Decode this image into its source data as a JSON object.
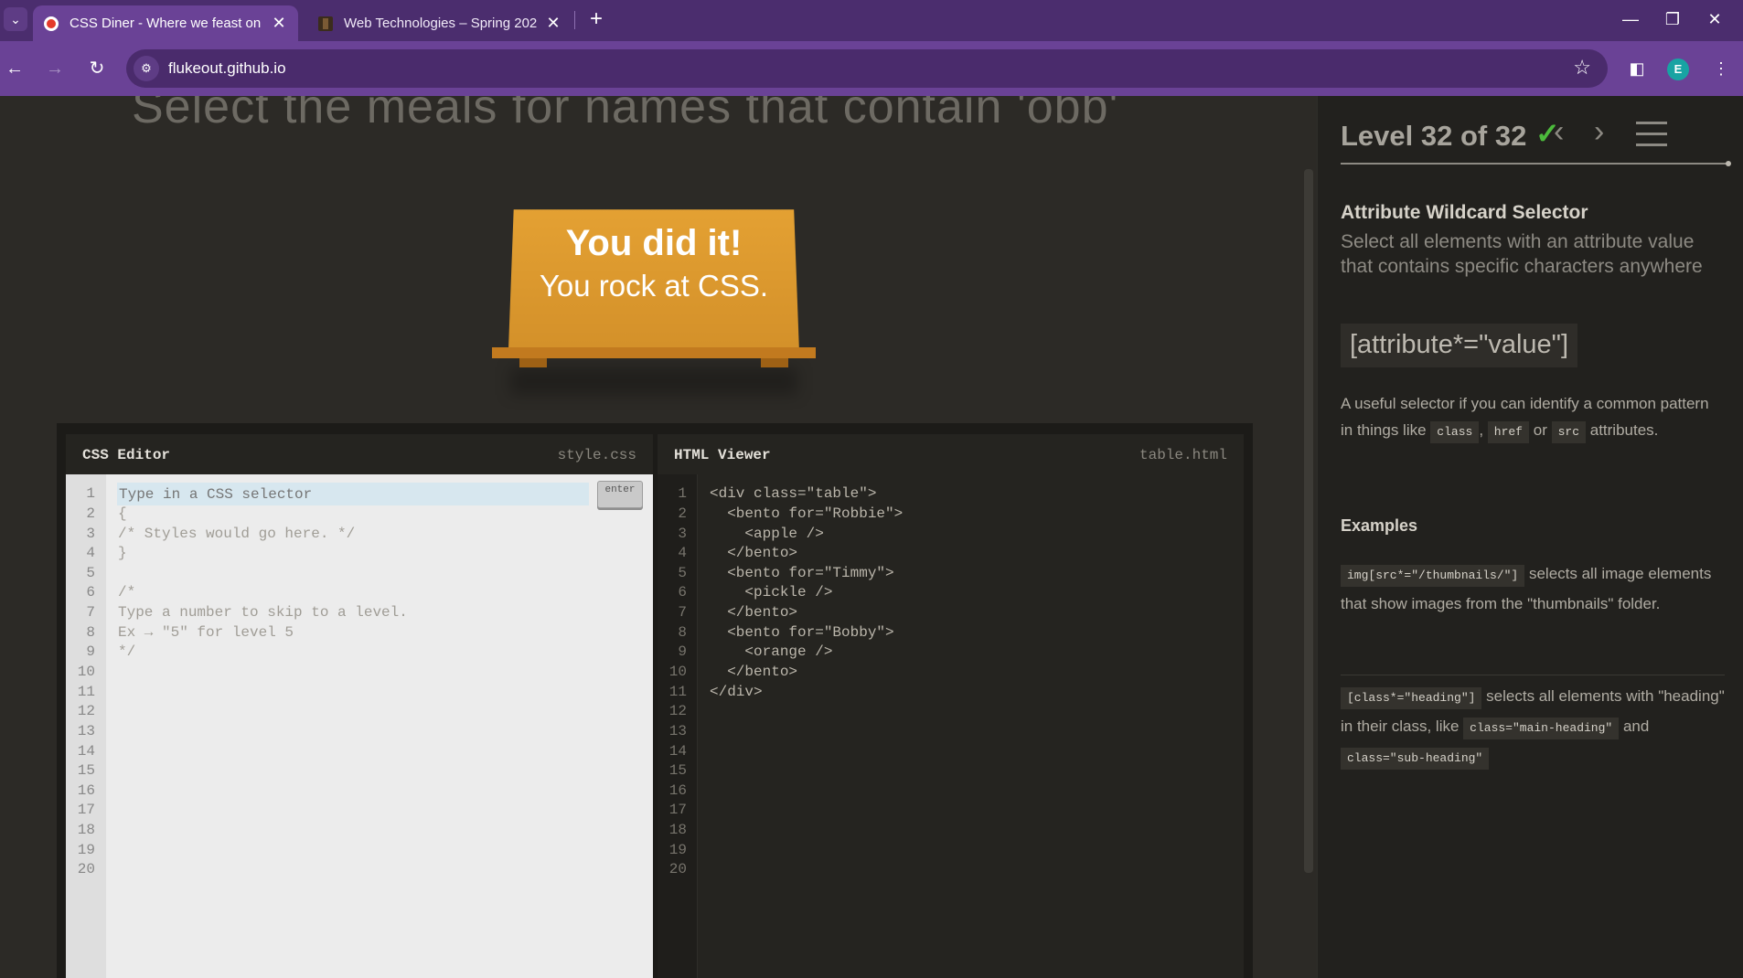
{
  "browser": {
    "tabs": [
      {
        "title": "CSS Diner - Where we feast on",
        "active": true
      },
      {
        "title": "Web Technologies – Spring 202",
        "active": false
      }
    ],
    "url": "flukeout.github.io",
    "profile_initial": "E"
  },
  "page": {
    "order_text": "Select the meals for names that contain 'obb'",
    "win": {
      "line1": "You did it!",
      "line2": "You rock at CSS."
    }
  },
  "css_editor": {
    "title": "CSS Editor",
    "file": "style.css",
    "placeholder": "Type in a CSS selector",
    "enter_label": "enter",
    "lines": [
      "{",
      "/* Styles would go here. */",
      "}",
      "",
      "/*",
      "Type a number to skip to a level.",
      "Ex → \"5\" for level 5",
      "*/"
    ],
    "line_numbers": [
      "1",
      "2",
      "3",
      "4",
      "5",
      "6",
      "7",
      "8",
      "9",
      "10",
      "11",
      "12",
      "13",
      "14",
      "15",
      "16",
      "17",
      "18",
      "19",
      "20"
    ]
  },
  "html_viewer": {
    "title": "HTML Viewer",
    "file": "table.html",
    "lines": [
      "<div class=\"table\">",
      "  <bento for=\"Robbie\">",
      "    <apple />",
      "  </bento>",
      "  <bento for=\"Timmy\">",
      "    <pickle />",
      "  </bento>",
      "  <bento for=\"Bobby\">",
      "    <orange />",
      "  </bento>",
      "</div>"
    ],
    "line_numbers": [
      "1",
      "2",
      "3",
      "4",
      "5",
      "6",
      "7",
      "8",
      "9",
      "10",
      "11",
      "12",
      "13",
      "14",
      "15",
      "16",
      "17",
      "18",
      "19",
      "20"
    ]
  },
  "sidebar": {
    "level_label": "Level 32 of 32",
    "check": "✓",
    "progress": 1.0,
    "selector_name": "Attribute Wildcard Selector",
    "selector_title": "Select all elements with an attribute value that contains specific characters anywhere",
    "syntax": "[attribute*=\"value\"]",
    "hint_text": "A useful selector if you can identify a common pattern in things like",
    "hint_chips": [
      "class",
      "href",
      "src"
    ],
    "hint_sep1": ",",
    "hint_or": "or",
    "hint_end": "attributes.",
    "examples_heading": "Examples",
    "example1_code": "img[src*=\"/thumbnails/\"]",
    "example1_text": "selects all image elements that show images from the \"thumbnails\" folder.",
    "example2_code": "[class*=\"heading\"]",
    "example2_text": "selects all elements with \"heading\" in their class, like",
    "example2_chip1": "class=\"main-heading\"",
    "example2_and": "and",
    "example2_chip2": "class=\"sub-heading\""
  },
  "icons": {
    "back": "arrow-left-icon",
    "forward": "arrow-right-icon",
    "reload": "reload-icon",
    "site_info": "tune-icon",
    "bookmark": "star-icon",
    "side_panel": "side-panel-icon",
    "menu": "kebab-menu-icon",
    "level_prev": "chevron-left-icon",
    "level_next": "chevron-right-icon",
    "level_menu": "hamburger-icon"
  },
  "colors": {
    "accent_purple": "#6a4296",
    "table_orange": "#e4a133",
    "check_green": "#4cbb3c"
  }
}
